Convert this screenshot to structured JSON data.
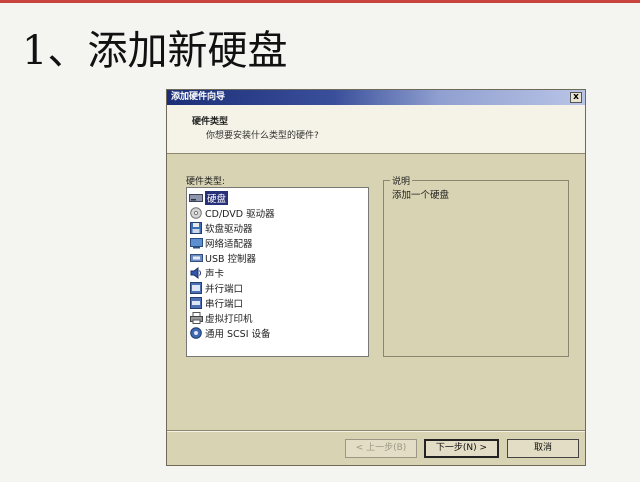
{
  "slide": {
    "title": "1、添加新硬盘"
  },
  "dialog": {
    "title": "添加硬件向导",
    "close_label": "x",
    "header": {
      "title": "硬件类型",
      "subtitle": "你想要安装什么类型的硬件?"
    },
    "list_label": "硬件类型:",
    "items": [
      {
        "label": "硬盘",
        "icon": "hard-disk-icon",
        "selected": true
      },
      {
        "label": "CD/DVD 驱动器",
        "icon": "cd-dvd-drive-icon",
        "selected": false
      },
      {
        "label": "软盘驱动器",
        "icon": "floppy-drive-icon",
        "selected": false
      },
      {
        "label": "网络适配器",
        "icon": "network-adapter-icon",
        "selected": false
      },
      {
        "label": "USB 控制器",
        "icon": "usb-controller-icon",
        "selected": false
      },
      {
        "label": "声卡",
        "icon": "sound-card-icon",
        "selected": false
      },
      {
        "label": "并行端口",
        "icon": "parallel-port-icon",
        "selected": false
      },
      {
        "label": "串行端口",
        "icon": "serial-port-icon",
        "selected": false
      },
      {
        "label": "虚拟打印机",
        "icon": "printer-icon",
        "selected": false
      },
      {
        "label": "通用 SCSI 设备",
        "icon": "scsi-device-icon",
        "selected": false
      }
    ],
    "description": {
      "legend": "说明",
      "text": "添加一个硬盘"
    },
    "buttons": {
      "back": "< 上一步(B)",
      "next": "下一步(N) >",
      "cancel": "取消"
    }
  }
}
